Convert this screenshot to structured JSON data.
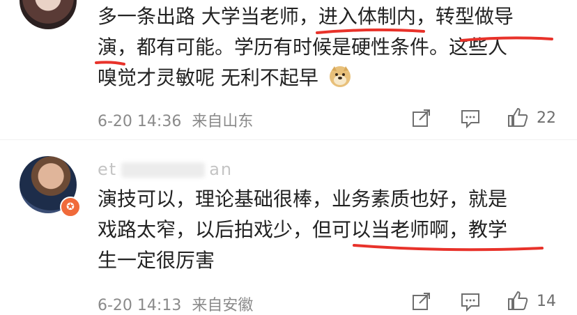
{
  "comments": [
    {
      "text_line1": "多一条出路 大学当老师，进入体制内，转型做导",
      "text_line2": "演，都有可能。学历有时候是硬性条件。这些人",
      "text_line3": "嗅觉才灵敏呢 无利不起早",
      "emoji": "doge-emoji",
      "date": "6-20 14:36",
      "location": "来自山东",
      "likes": "22"
    },
    {
      "username_start": "et",
      "username_end": "an",
      "text_line1": "演技可以，理论基础很棒，业务素质也好，就是",
      "text_line2": "戏路太窄，以后拍戏少，但可以当老师啊，教学",
      "text_line3": "生一定很厉害",
      "date": "6-20 14:13",
      "location": "来自安徽",
      "likes": "14"
    }
  ],
  "colors": {
    "underline": "#e8322a",
    "meta": "#8a8a8a",
    "text": "#222222",
    "badge": "#f06a3a"
  }
}
